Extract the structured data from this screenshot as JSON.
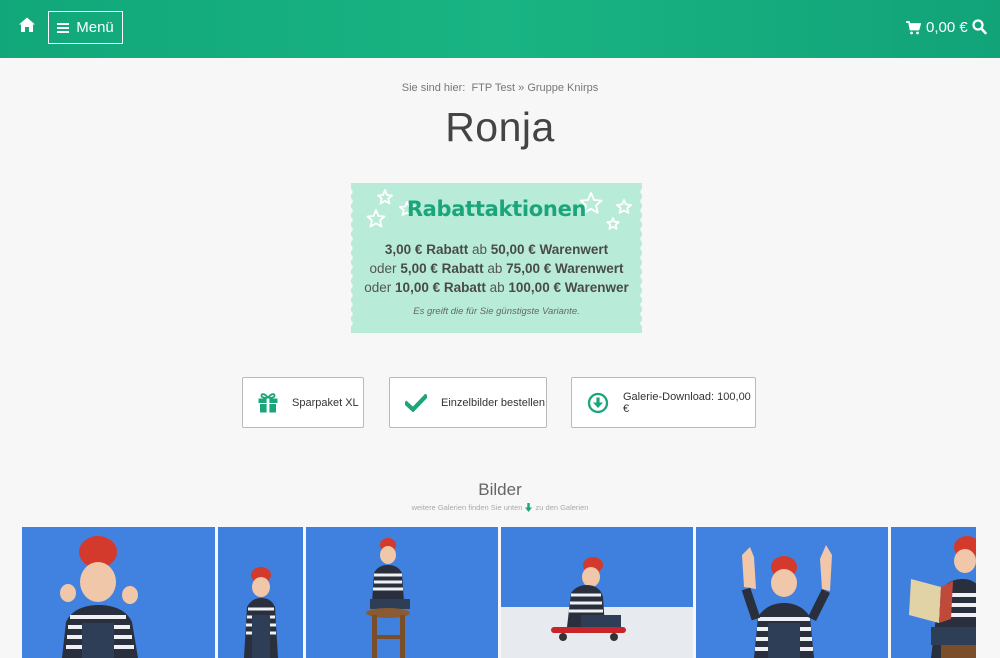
{
  "header": {
    "menu_label": "Menü",
    "cart_total": "0,00 €",
    "icons": [
      "home-icon",
      "menu-icon",
      "cart-icon",
      "search-icon"
    ],
    "bg_color": "#16ad7e"
  },
  "breadcrumb": {
    "prefix": "Sie sind hier:",
    "items": [
      "FTP Test",
      "Gruppe Knirps"
    ],
    "separator": "»"
  },
  "page_title": "Ronja",
  "coupon": {
    "title": "Rabattaktionen",
    "lines": [
      {
        "pre": "",
        "amount": "3,00 € Rabatt",
        "mid": "ab",
        "threshold": "50,00 € Warenwert"
      },
      {
        "pre": "oder",
        "amount": "5,00 € Rabatt",
        "mid": "ab",
        "threshold": "75,00 € Warenwert"
      },
      {
        "pre": "oder",
        "amount": "10,00 € Rabatt",
        "mid": "ab",
        "threshold": "100,00 € Warenwer"
      }
    ],
    "note": "Es greift die für Sie günstigste Variante.",
    "bg_color": "#b8ecd8",
    "accent_color": "#1aa57a"
  },
  "actions": [
    {
      "label": "Sparpaket XL",
      "icon": "gift-icon"
    },
    {
      "label": "Einzelbilder bestellen",
      "icon": "checkmark-icon"
    },
    {
      "label": "Galerie-Download: 100,00 €",
      "icon": "download-circle-icon"
    }
  ],
  "gallery": {
    "title": "Bilder",
    "hint": "weitere Galerien finden Sie unten",
    "hint_link": "zu den Galerien"
  }
}
